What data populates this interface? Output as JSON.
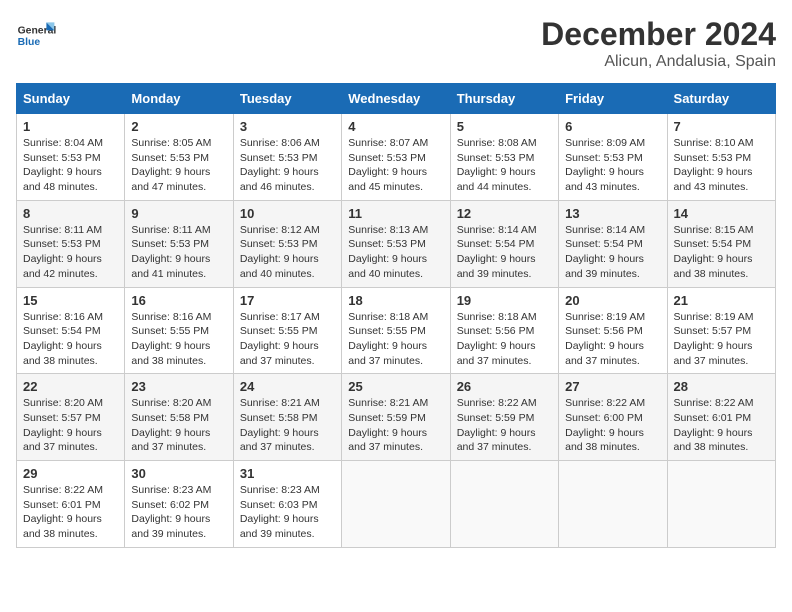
{
  "header": {
    "logo_text_general": "General",
    "logo_text_blue": "Blue",
    "month": "December 2024",
    "location": "Alicun, Andalusia, Spain"
  },
  "weekdays": [
    "Sunday",
    "Monday",
    "Tuesday",
    "Wednesday",
    "Thursday",
    "Friday",
    "Saturday"
  ],
  "weeks": [
    [
      {
        "day": 1,
        "info": "Sunrise: 8:04 AM\nSunset: 5:53 PM\nDaylight: 9 hours\nand 48 minutes."
      },
      {
        "day": 2,
        "info": "Sunrise: 8:05 AM\nSunset: 5:53 PM\nDaylight: 9 hours\nand 47 minutes."
      },
      {
        "day": 3,
        "info": "Sunrise: 8:06 AM\nSunset: 5:53 PM\nDaylight: 9 hours\nand 46 minutes."
      },
      {
        "day": 4,
        "info": "Sunrise: 8:07 AM\nSunset: 5:53 PM\nDaylight: 9 hours\nand 45 minutes."
      },
      {
        "day": 5,
        "info": "Sunrise: 8:08 AM\nSunset: 5:53 PM\nDaylight: 9 hours\nand 44 minutes."
      },
      {
        "day": 6,
        "info": "Sunrise: 8:09 AM\nSunset: 5:53 PM\nDaylight: 9 hours\nand 43 minutes."
      },
      {
        "day": 7,
        "info": "Sunrise: 8:10 AM\nSunset: 5:53 PM\nDaylight: 9 hours\nand 43 minutes."
      }
    ],
    [
      {
        "day": 8,
        "info": "Sunrise: 8:11 AM\nSunset: 5:53 PM\nDaylight: 9 hours\nand 42 minutes."
      },
      {
        "day": 9,
        "info": "Sunrise: 8:11 AM\nSunset: 5:53 PM\nDaylight: 9 hours\nand 41 minutes."
      },
      {
        "day": 10,
        "info": "Sunrise: 8:12 AM\nSunset: 5:53 PM\nDaylight: 9 hours\nand 40 minutes."
      },
      {
        "day": 11,
        "info": "Sunrise: 8:13 AM\nSunset: 5:53 PM\nDaylight: 9 hours\nand 40 minutes."
      },
      {
        "day": 12,
        "info": "Sunrise: 8:14 AM\nSunset: 5:54 PM\nDaylight: 9 hours\nand 39 minutes."
      },
      {
        "day": 13,
        "info": "Sunrise: 8:14 AM\nSunset: 5:54 PM\nDaylight: 9 hours\nand 39 minutes."
      },
      {
        "day": 14,
        "info": "Sunrise: 8:15 AM\nSunset: 5:54 PM\nDaylight: 9 hours\nand 38 minutes."
      }
    ],
    [
      {
        "day": 15,
        "info": "Sunrise: 8:16 AM\nSunset: 5:54 PM\nDaylight: 9 hours\nand 38 minutes."
      },
      {
        "day": 16,
        "info": "Sunrise: 8:16 AM\nSunset: 5:55 PM\nDaylight: 9 hours\nand 38 minutes."
      },
      {
        "day": 17,
        "info": "Sunrise: 8:17 AM\nSunset: 5:55 PM\nDaylight: 9 hours\nand 37 minutes."
      },
      {
        "day": 18,
        "info": "Sunrise: 8:18 AM\nSunset: 5:55 PM\nDaylight: 9 hours\nand 37 minutes."
      },
      {
        "day": 19,
        "info": "Sunrise: 8:18 AM\nSunset: 5:56 PM\nDaylight: 9 hours\nand 37 minutes."
      },
      {
        "day": 20,
        "info": "Sunrise: 8:19 AM\nSunset: 5:56 PM\nDaylight: 9 hours\nand 37 minutes."
      },
      {
        "day": 21,
        "info": "Sunrise: 8:19 AM\nSunset: 5:57 PM\nDaylight: 9 hours\nand 37 minutes."
      }
    ],
    [
      {
        "day": 22,
        "info": "Sunrise: 8:20 AM\nSunset: 5:57 PM\nDaylight: 9 hours\nand 37 minutes."
      },
      {
        "day": 23,
        "info": "Sunrise: 8:20 AM\nSunset: 5:58 PM\nDaylight: 9 hours\nand 37 minutes."
      },
      {
        "day": 24,
        "info": "Sunrise: 8:21 AM\nSunset: 5:58 PM\nDaylight: 9 hours\nand 37 minutes."
      },
      {
        "day": 25,
        "info": "Sunrise: 8:21 AM\nSunset: 5:59 PM\nDaylight: 9 hours\nand 37 minutes."
      },
      {
        "day": 26,
        "info": "Sunrise: 8:22 AM\nSunset: 5:59 PM\nDaylight: 9 hours\nand 37 minutes."
      },
      {
        "day": 27,
        "info": "Sunrise: 8:22 AM\nSunset: 6:00 PM\nDaylight: 9 hours\nand 38 minutes."
      },
      {
        "day": 28,
        "info": "Sunrise: 8:22 AM\nSunset: 6:01 PM\nDaylight: 9 hours\nand 38 minutes."
      }
    ],
    [
      {
        "day": 29,
        "info": "Sunrise: 8:22 AM\nSunset: 6:01 PM\nDaylight: 9 hours\nand 38 minutes."
      },
      {
        "day": 30,
        "info": "Sunrise: 8:23 AM\nSunset: 6:02 PM\nDaylight: 9 hours\nand 39 minutes."
      },
      {
        "day": 31,
        "info": "Sunrise: 8:23 AM\nSunset: 6:03 PM\nDaylight: 9 hours\nand 39 minutes."
      },
      null,
      null,
      null,
      null
    ]
  ]
}
